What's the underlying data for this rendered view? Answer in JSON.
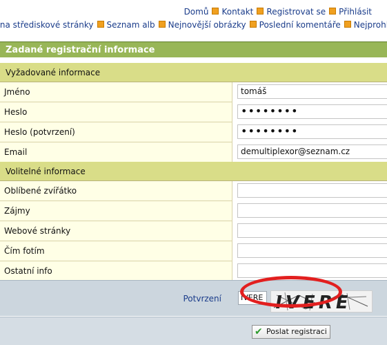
{
  "nav_top": [
    "Domů",
    "Kontakt",
    "Registrovat se",
    "Přihlásit"
  ],
  "nav_second": [
    "ět na střediskové stránky",
    "Seznam alb",
    "Nejnovější obrázky",
    "Poslední komentáře",
    "Nejprohlíženějš"
  ],
  "form": {
    "title": "Zadané registrační informace",
    "required_title": "Vyžadované informace",
    "required": [
      {
        "label": "Jméno",
        "value": "tomáš"
      },
      {
        "label": "Heslo",
        "value": "••••••••"
      },
      {
        "label": "Heslo (potvrzení)",
        "value": "••••••••"
      },
      {
        "label": "Email",
        "value": "demultiplexor@seznam.cz"
      }
    ],
    "optional_title": "Volitelné informace",
    "optional": [
      {
        "label": "Oblíbené zvířátko",
        "value": ""
      },
      {
        "label": "Zájmy",
        "value": ""
      },
      {
        "label": "Webové stránky",
        "value": ""
      },
      {
        "label": "Čím fotím",
        "value": ""
      },
      {
        "label": "Ostatní info",
        "value": ""
      }
    ],
    "confirm_label": "Potvrzení",
    "captcha_value": "IVERE",
    "captcha_text": "IVERE",
    "submit_label": "Poslat registraci"
  },
  "colors": {
    "header": "#98b657",
    "section": "#d9dd88",
    "row": "#ffffe6",
    "nav_link": "#1a3c8a",
    "highlight_oval": "#e21f1f"
  }
}
